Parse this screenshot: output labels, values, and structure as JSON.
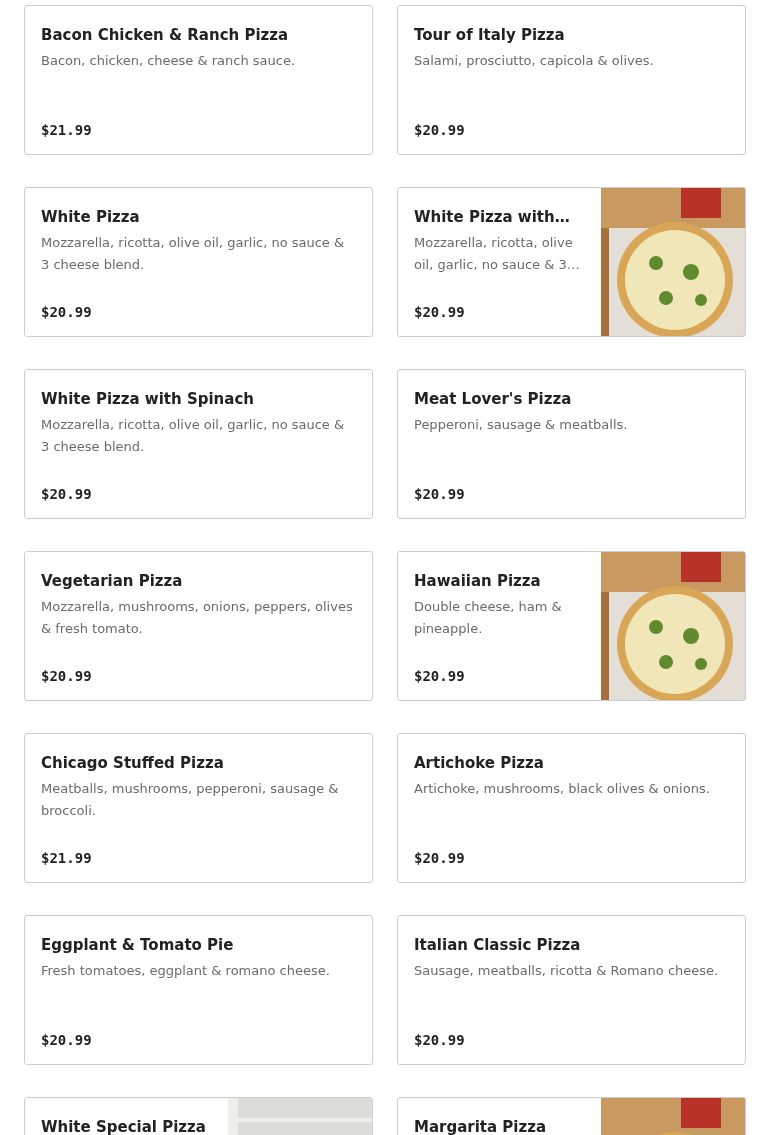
{
  "menu_items": [
    {
      "name": "Bacon Chicken & Ranch Pizza",
      "description": "Bacon, chicken, cheese & ranch sauce.",
      "price": "$21.99"
    },
    {
      "name": "Tour of Italy Pizza",
      "description": "Salami, prosciutto, capicola & olives.",
      "price": "$20.99"
    },
    {
      "name": "White Pizza",
      "description": "Mozzarella, ricotta, olive oil, garlic, no sauce & 3 cheese blend.",
      "price": "$20.99"
    },
    {
      "name": "White Pizza with…",
      "description": "Mozzarella, ricotta, olive oil, garlic, no sauce & 3…",
      "price": "$20.99"
    },
    {
      "name": "White Pizza with Spinach",
      "description": "Mozzarella, ricotta, olive oil, garlic, no sauce & 3 cheese blend.",
      "price": "$20.99"
    },
    {
      "name": "Meat Lover's Pizza",
      "description": "Pepperoni, sausage & meatballs.",
      "price": "$20.99"
    },
    {
      "name": "Vegetarian Pizza",
      "description": "Mozzarella, mushrooms, onions, peppers, olives & fresh tomato.",
      "price": "$20.99"
    },
    {
      "name": "Hawaiian Pizza",
      "description": "Double cheese, ham & pineapple.",
      "price": "$20.99"
    },
    {
      "name": "Chicago Stuffed Pizza",
      "description": "Meatballs, mushrooms, pepperoni, sausage & broccoli.",
      "price": "$21.99"
    },
    {
      "name": "Artichoke Pizza",
      "description": "Artichoke, mushrooms, black olives & onions.",
      "price": "$20.99"
    },
    {
      "name": "Eggplant & Tomato Pie",
      "description": "Fresh tomatoes, eggplant & romano cheese.",
      "price": "$20.99"
    },
    {
      "name": "Italian Classic Pizza",
      "description": "Sausage, meatballs, ricotta & Romano cheese.",
      "price": "$20.99"
    },
    {
      "name": "White Special Pizza"
    },
    {
      "name": "Margarita Pizza"
    }
  ]
}
